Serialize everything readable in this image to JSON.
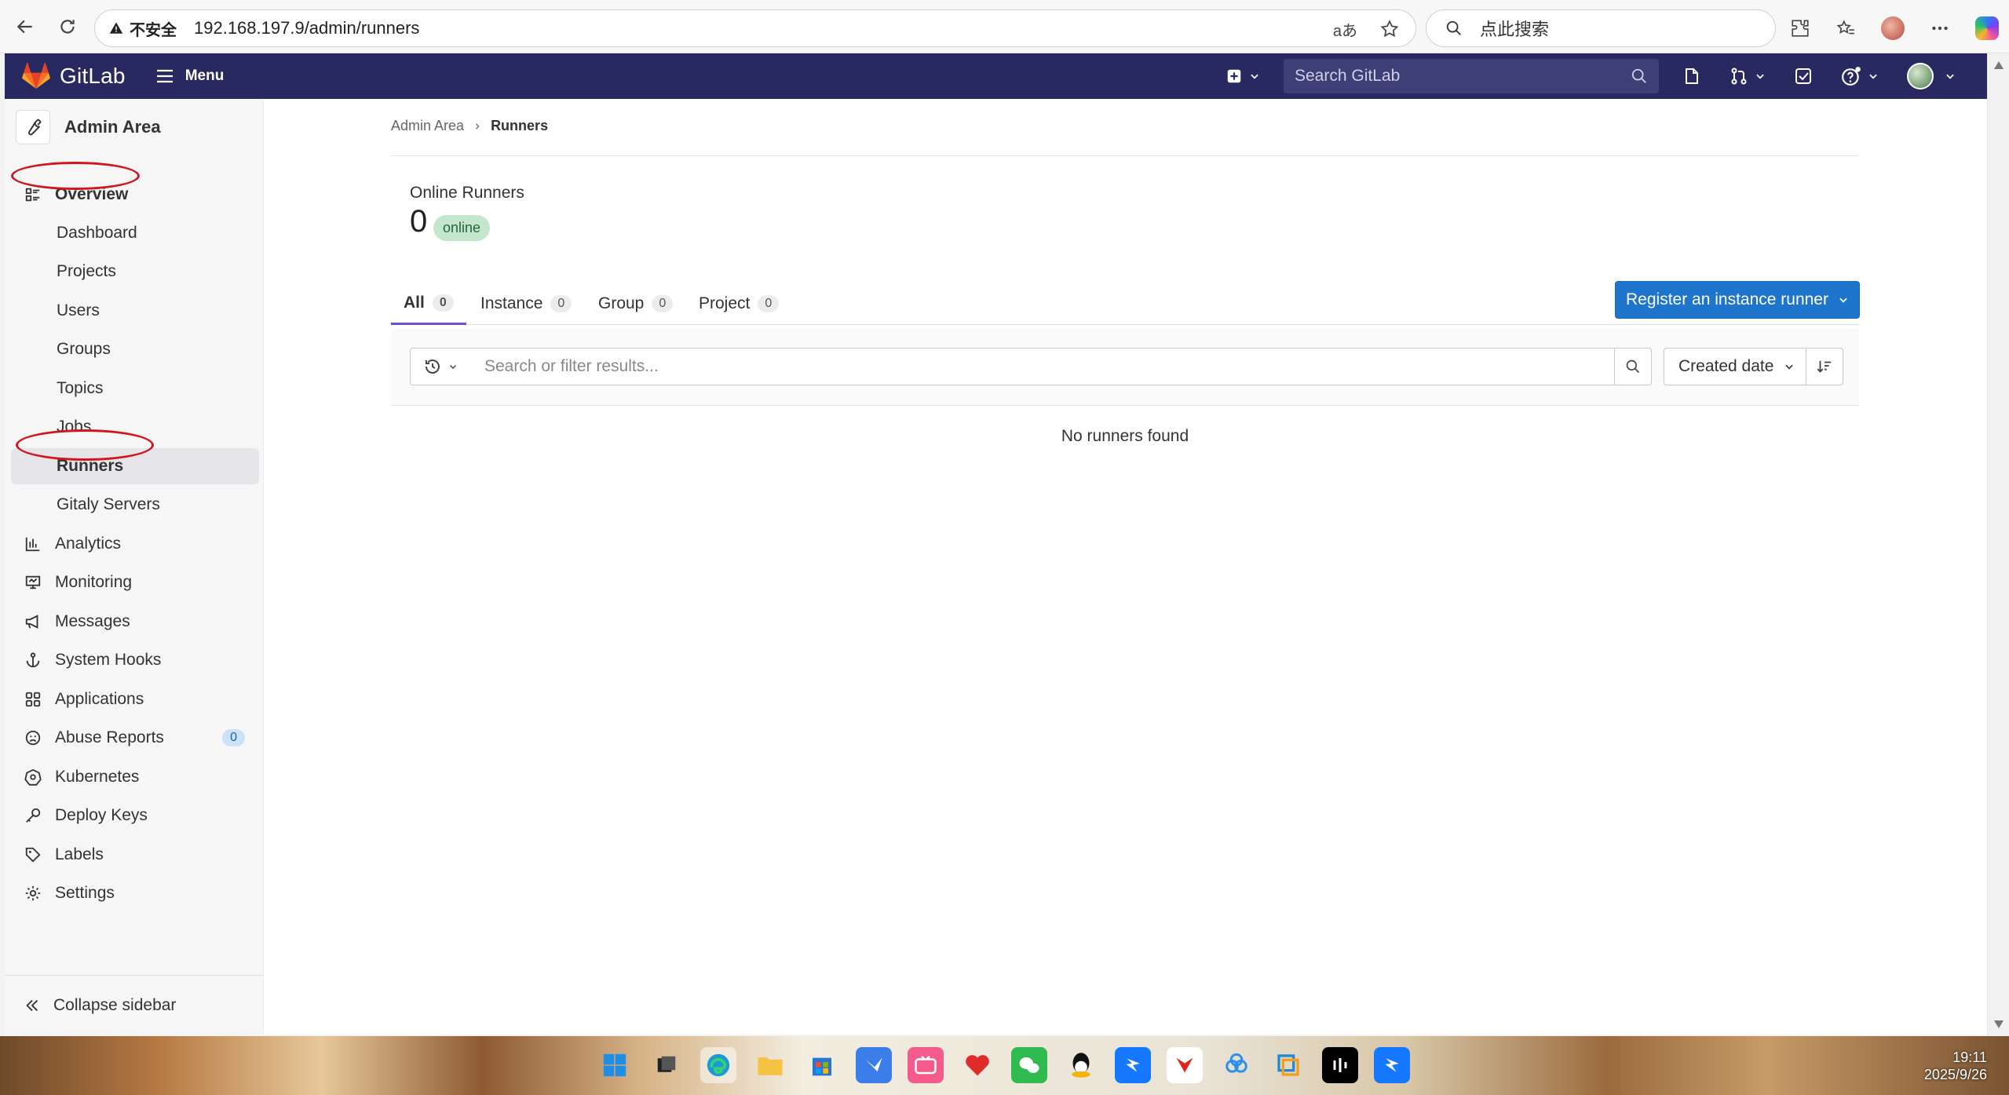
{
  "browser": {
    "security_label": "不安全",
    "url": "192.168.197.9/admin/runners",
    "search_placeholder": "点此搜索",
    "translate_label": "aあ"
  },
  "topnav": {
    "logo": "GitLab",
    "menu": "Menu",
    "search_placeholder": "Search GitLab"
  },
  "sidebar": {
    "title": "Admin Area",
    "items": [
      {
        "label": "Overview",
        "icon": "overview-icon"
      },
      {
        "label": "Dashboard"
      },
      {
        "label": "Projects"
      },
      {
        "label": "Users"
      },
      {
        "label": "Groups"
      },
      {
        "label": "Topics"
      },
      {
        "label": "Jobs"
      },
      {
        "label": "Runners"
      },
      {
        "label": "Gitaly Servers"
      },
      {
        "label": "Analytics",
        "icon": "analytics-icon"
      },
      {
        "label": "Monitoring",
        "icon": "monitor-icon"
      },
      {
        "label": "Messages",
        "icon": "bullhorn-icon"
      },
      {
        "label": "System Hooks",
        "icon": "anchor-icon"
      },
      {
        "label": "Applications",
        "icon": "grid-icon"
      },
      {
        "label": "Abuse Reports",
        "icon": "frown-icon",
        "badge": "0"
      },
      {
        "label": "Kubernetes",
        "icon": "kubernetes-icon"
      },
      {
        "label": "Deploy Keys",
        "icon": "key-icon"
      },
      {
        "label": "Labels",
        "icon": "label-icon"
      },
      {
        "label": "Settings",
        "icon": "gear-icon"
      }
    ],
    "collapse": "Collapse sidebar"
  },
  "breadcrumb": {
    "root": "Admin Area",
    "current": "Runners"
  },
  "stats": {
    "label": "Online Runners",
    "count": "0",
    "badge": "online"
  },
  "tabs": [
    {
      "label": "All",
      "count": "0"
    },
    {
      "label": "Instance",
      "count": "0"
    },
    {
      "label": "Group",
      "count": "0"
    },
    {
      "label": "Project",
      "count": "0"
    }
  ],
  "register_button": "Register an instance runner",
  "filter": {
    "placeholder": "Search or filter results...",
    "sort": "Created date"
  },
  "empty_state": "No runners found",
  "taskbar": {
    "time": "19:11",
    "date": "2025/9/26"
  },
  "colors": {
    "navbar": "#292961",
    "primary_button": "#1f75cb",
    "active_tab": "#6f4fd6",
    "annotation_ring": "#d2161d"
  }
}
